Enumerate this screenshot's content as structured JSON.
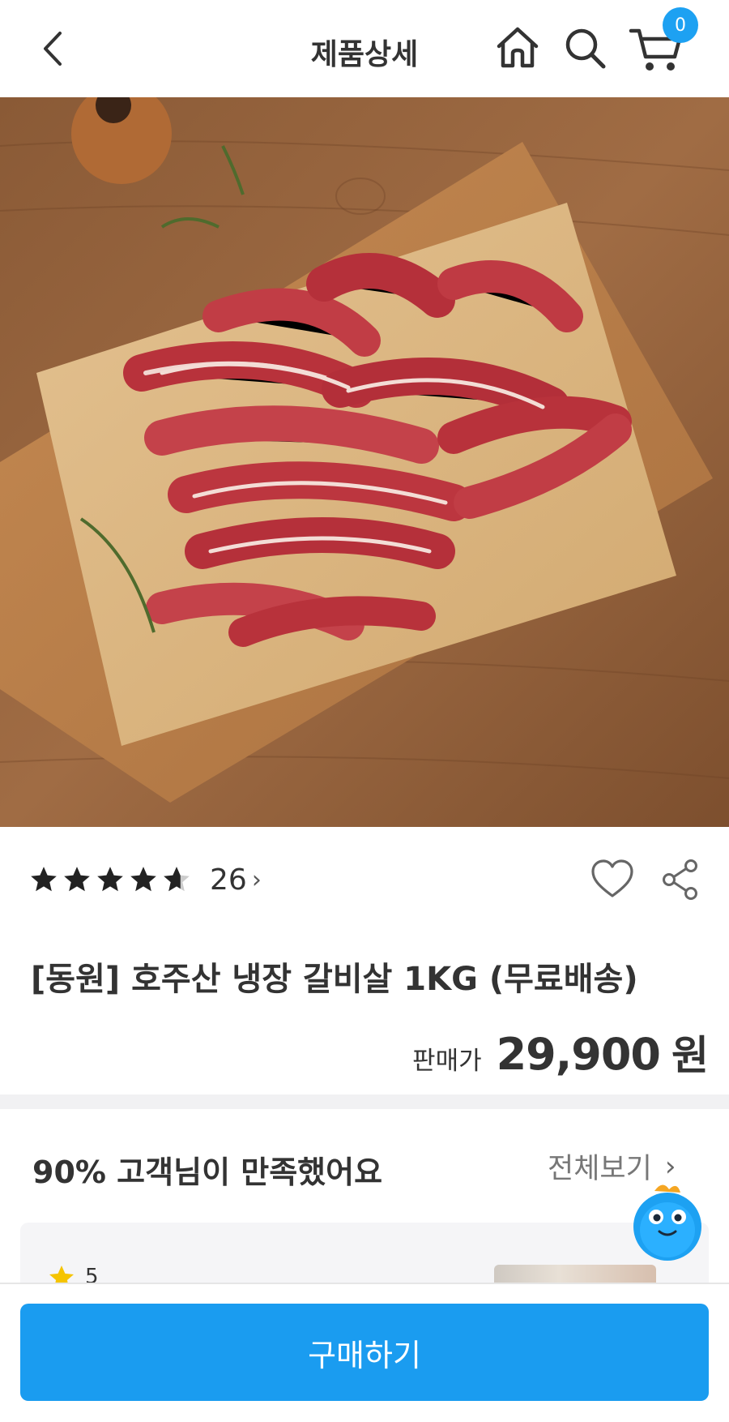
{
  "header": {
    "title": "제품상세",
    "cart_count": "0"
  },
  "product": {
    "rating": 4.5,
    "review_count": "26",
    "title": "[동원] 호주산 냉장 갈비살 1KG (무료배송)",
    "price_label": "판매가",
    "price_value": "29,900",
    "price_unit": "원"
  },
  "reviews": {
    "satisfaction_text": "90% 고객님이 만족했어요",
    "view_all_label": "전체보기",
    "first_review_score": "5"
  },
  "actions": {
    "buy_label": "구매하기"
  },
  "colors": {
    "accent": "#1a9cf0",
    "badge": "#1da1f2",
    "divider": "#f1f1f3"
  },
  "icons": [
    "back-icon",
    "home-icon",
    "search-icon",
    "cart-icon",
    "star-icon",
    "heart-icon",
    "share-icon",
    "chevron-right-icon",
    "mascot-icon"
  ]
}
